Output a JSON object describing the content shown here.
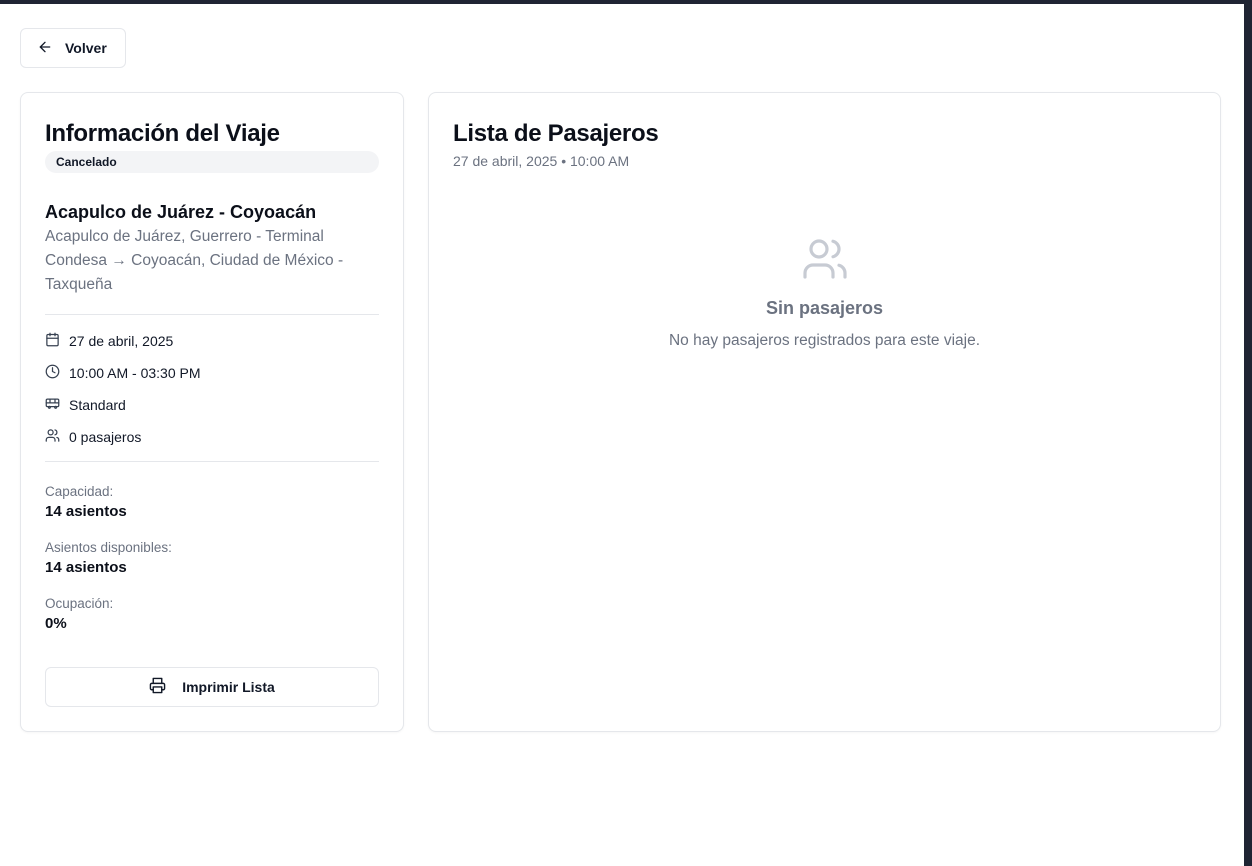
{
  "header": {
    "back_label": "Volver"
  },
  "trip": {
    "title": "Información del Viaje",
    "status": "Cancelado",
    "route_name": "Acapulco de Juárez - Coyoacán",
    "route_desc": "Acapulco de Juárez, Guerrero - Terminal Condesa → Coyoacán, Ciudad de México - Taxqueña",
    "date": "27 de abril, 2025",
    "time": "10:00 AM - 03:30 PM",
    "bus_type": "Standard",
    "passengers": "0 pasajeros",
    "capacity_label": "Capacidad:",
    "capacity_value": "14 asientos",
    "available_label": "Asientos disponibles:",
    "available_value": "14 asientos",
    "occupancy_label": "Ocupación:",
    "occupancy_value": "0%",
    "print_label": "Imprimir Lista"
  },
  "passengers_panel": {
    "title": "Lista de Pasajeros",
    "subtitle": "27 de abril, 2025 • 10:00 AM",
    "empty_title": "Sin pasajeros",
    "empty_desc": "No hay pasajeros registrados para este viaje."
  },
  "icons": {
    "back": "arrow-left-icon",
    "date": "calendar-icon",
    "time": "clock-icon",
    "bus": "bus-icon",
    "passengers": "users-icon",
    "print": "printer-icon",
    "empty": "users-icon"
  }
}
